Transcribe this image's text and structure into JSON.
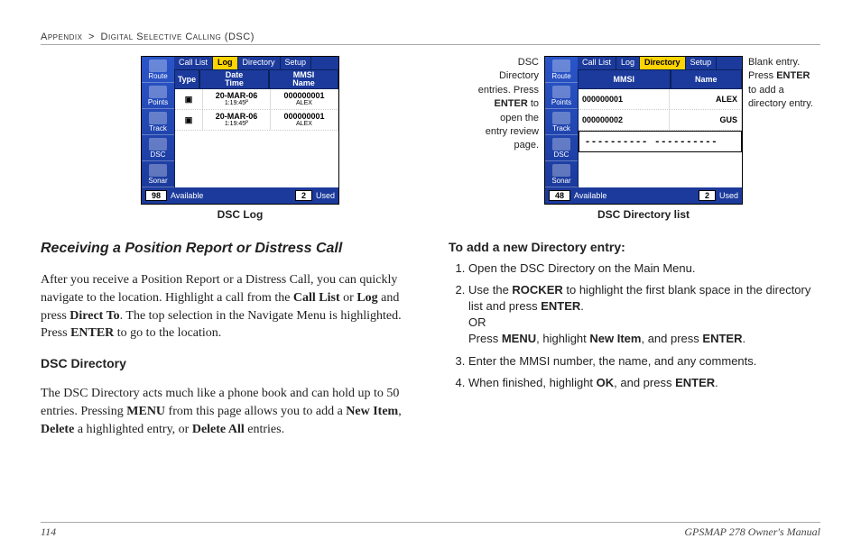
{
  "header": {
    "section": "Appendix",
    "subsection": "Digital Selective Calling (DSC)"
  },
  "fig1": {
    "caption": "DSC Log",
    "sidebar": [
      "Route",
      "Points",
      "Track",
      "DSC",
      "Sonar"
    ],
    "tabs": [
      "Call List",
      "Log",
      "Directory",
      "Setup"
    ],
    "activeTab": "Log",
    "colHeads": [
      "Type",
      "Date\nTime",
      "MMSI\nName"
    ],
    "rows": [
      {
        "type_icon": "▣",
        "date": "20-MAR-06",
        "time": "1:19:45ᴾ",
        "mmsi": "000000001",
        "name": "ALEX"
      },
      {
        "type_icon": "▣",
        "date": "20-MAR-06",
        "time": "1:19:45ᴾ",
        "mmsi": "000000001",
        "name": "ALEX"
      }
    ],
    "status": {
      "available": "98",
      "availLabel": "Available",
      "used": "2",
      "usedLabel": "Used"
    }
  },
  "fig2": {
    "caption": "DSC Directory list",
    "leftNote": "DSC Directory entries. Press ENTER to open the entry review page.",
    "rightNote": "Blank entry. Press ENTER to add a directory entry.",
    "sidebar": [
      "Route",
      "Points",
      "Track",
      "DSC",
      "Sonar"
    ],
    "tabs": [
      "Call List",
      "Log",
      "Directory",
      "Setup"
    ],
    "activeTab": "Directory",
    "colHeads": [
      "MMSI",
      "Name"
    ],
    "rows": [
      {
        "mmsi": "000000001",
        "name": "ALEX"
      },
      {
        "mmsi": "000000002",
        "name": "GUS"
      }
    ],
    "blankRow": "----------      ----------",
    "status": {
      "available": "48",
      "availLabel": "Available",
      "used": "2",
      "usedLabel": "Used"
    }
  },
  "leftCol": {
    "h2": "Receiving a Position Report or Distress Call",
    "p1a": "After you receive a Position Report or a Distress Call, you can quickly navigate to the location. Highlight a call from the ",
    "b1": "Call List",
    "p1b": " or ",
    "b2": "Log",
    "p1c": " and press ",
    "b3": "Direct To",
    "p1d": ". The top selection in the Navigate Menu is highlighted. Press ",
    "b4": "ENTER",
    "p1e": " to go to the location.",
    "h3": "DSC Directory",
    "p2a": "The DSC Directory acts much like a phone book and can hold up to 50 entries. Pressing ",
    "b5": "MENU",
    "p2b": " from this page allows you to add a ",
    "b6": "New Item",
    "p2c": ", ",
    "b7": "Delete",
    "p2d": " a highlighted entry, or ",
    "b8": "Delete All",
    "p2e": " entries."
  },
  "rightCol": {
    "h3": "To add a new Directory entry:",
    "steps": [
      "Open the DSC Directory on the Main Menu.",
      "Use the <b>ROCKER</b> to highlight the first blank space in the directory list and press <b>ENTER</b>.<br>OR<br>Press <b>MENU</b>, highlight <b>New Item</b>, and press <b>ENTER</b>.",
      "Enter the MMSI number, the name, and any comments.",
      "When finished, highlight <b>OK</b>, and press <b>ENTER</b>."
    ]
  },
  "footer": {
    "page": "114",
    "title": "GPSMAP 278 Owner's Manual"
  }
}
